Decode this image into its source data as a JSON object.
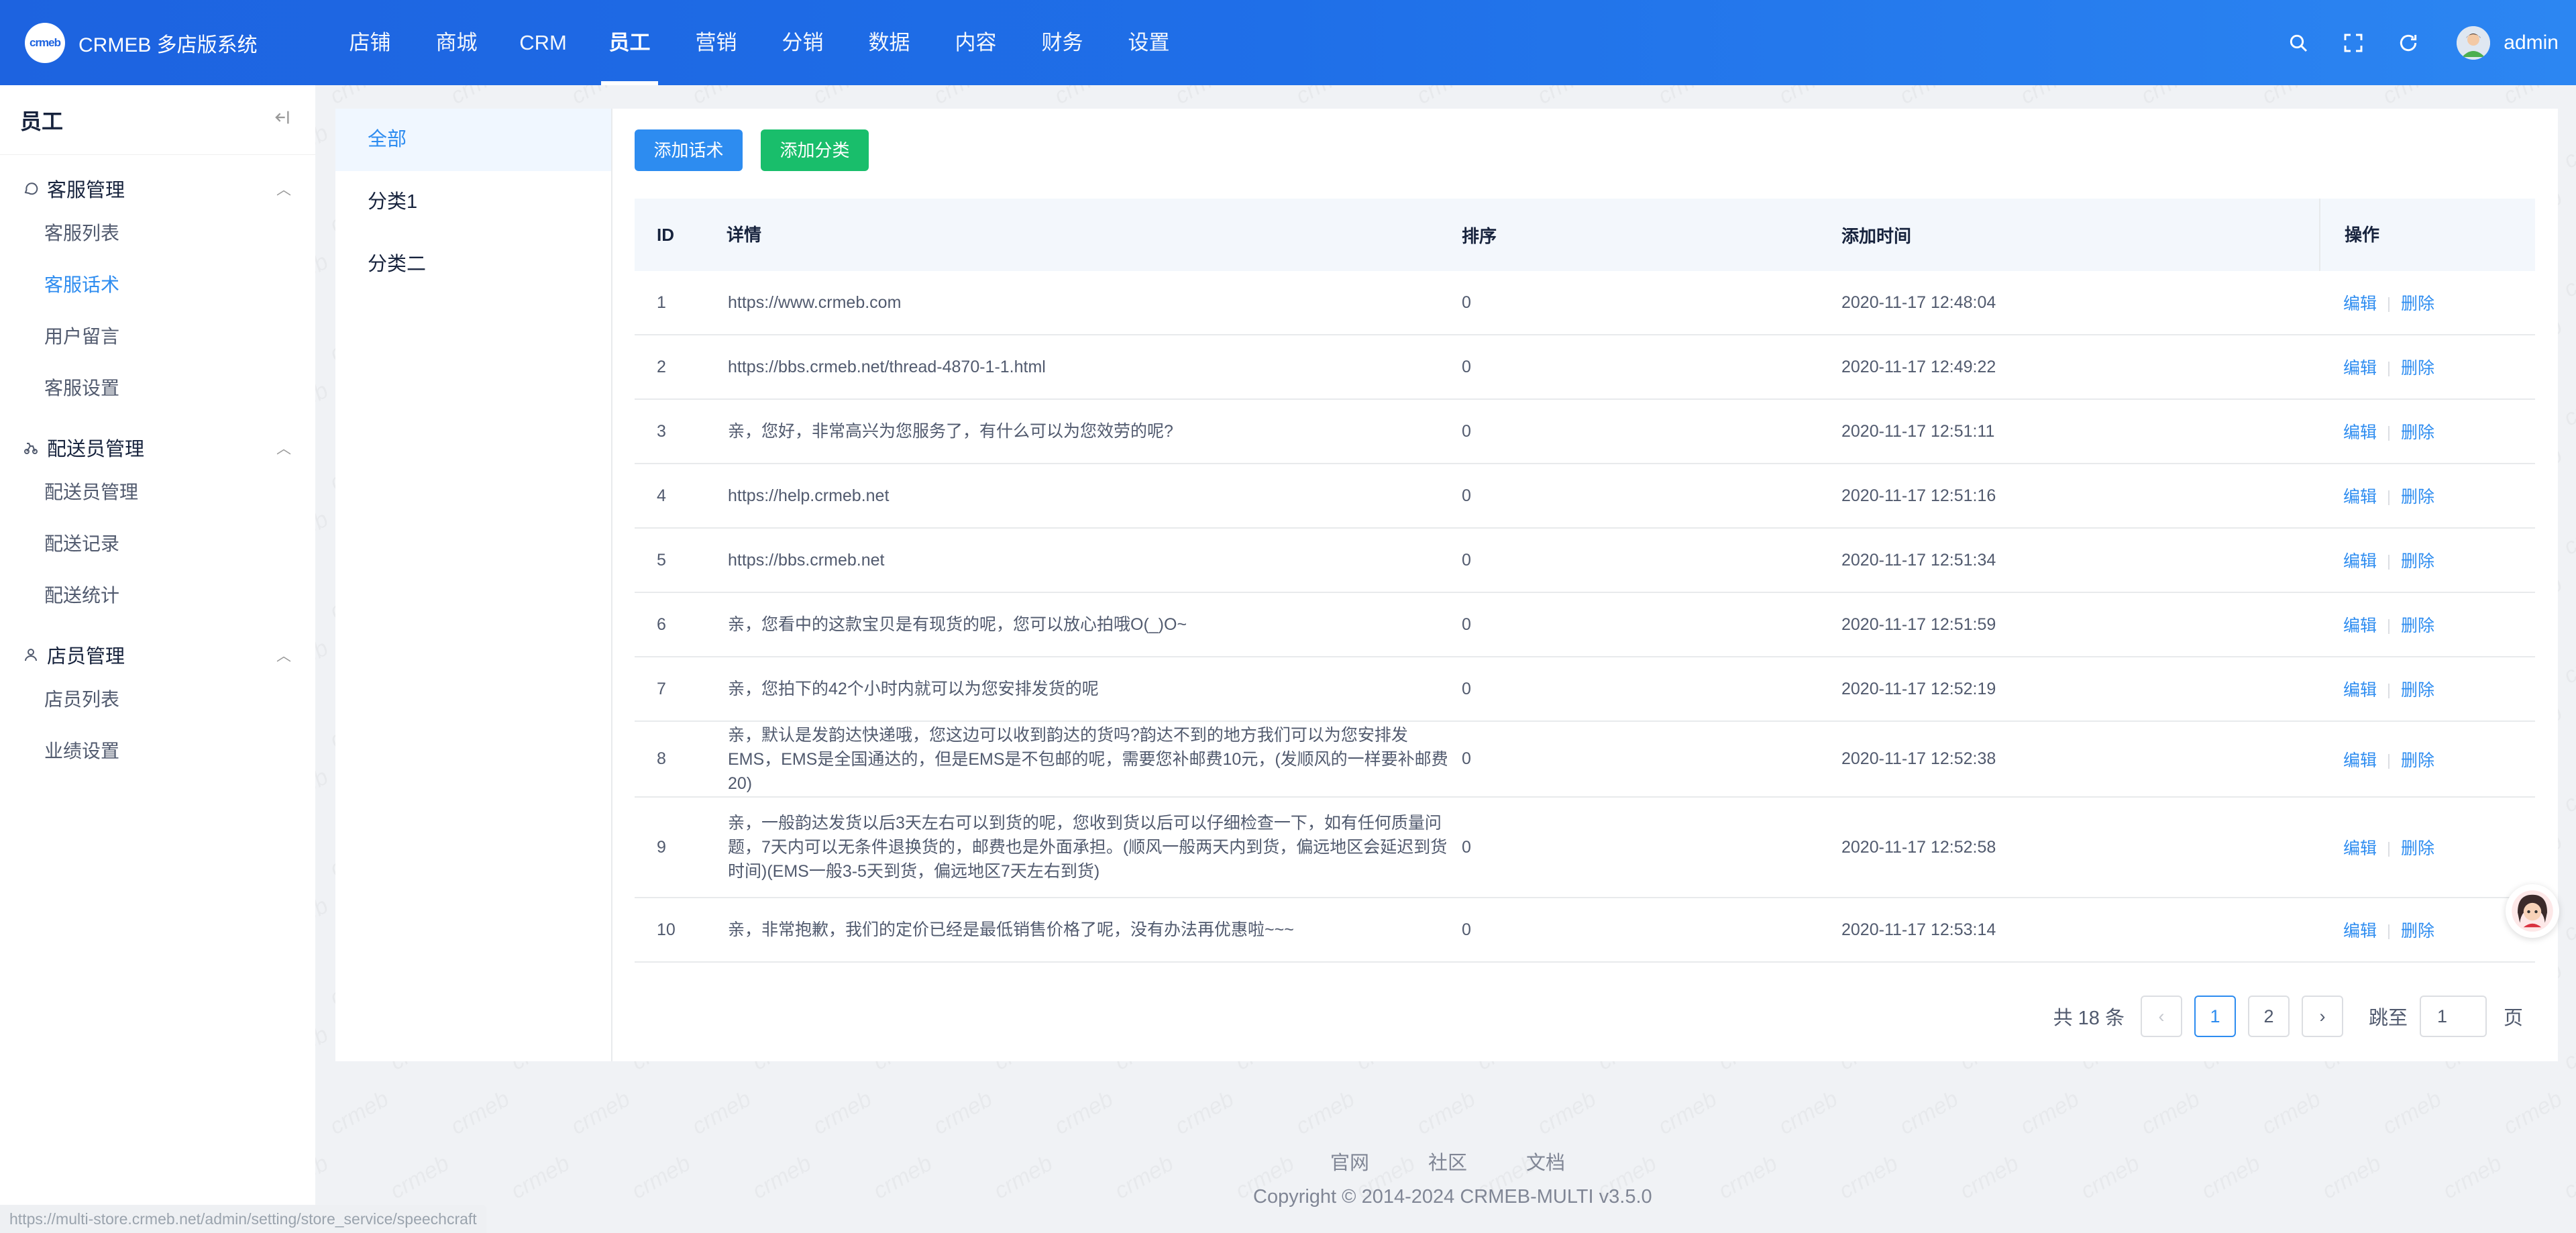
{
  "header": {
    "logo_mark": "crmeb",
    "app_title": "CRMEB 多店版系统",
    "nav": [
      "店铺",
      "商城",
      "CRM",
      "员工",
      "营销",
      "分销",
      "数据",
      "内容",
      "财务",
      "设置"
    ],
    "active_nav": "员工",
    "user_name": "admin",
    "icons": [
      "search-icon",
      "fullscreen-icon",
      "refresh-icon"
    ]
  },
  "sidebar": {
    "title": "员工",
    "groups": [
      {
        "label": "客服管理",
        "icon": "chat-icon",
        "items": [
          "客服列表",
          "客服话术",
          "用户留言",
          "客服设置"
        ]
      },
      {
        "label": "配送员管理",
        "icon": "delivery-icon",
        "items": [
          "配送员管理",
          "配送记录",
          "配送统计"
        ]
      },
      {
        "label": "店员管理",
        "icon": "user-icon",
        "items": [
          "店员列表",
          "业绩设置"
        ]
      }
    ],
    "active_item": "客服话术"
  },
  "submenu": {
    "items": [
      "全部",
      "分类1",
      "分类二"
    ],
    "active": "全部"
  },
  "toolbar": {
    "add_speech": "添加话术",
    "add_category": "添加分类"
  },
  "table": {
    "headers": {
      "id": "ID",
      "detail": "详情",
      "sort": "排序",
      "time": "添加时间",
      "op": "操作"
    },
    "op_edit": "编辑",
    "op_delete": "删除",
    "rows": [
      {
        "id": "1",
        "detail": "https://www.crmeb.com",
        "sort": "0",
        "time": "2020-11-17 12:48:04"
      },
      {
        "id": "2",
        "detail": "https://bbs.crmeb.net/thread-4870-1-1.html",
        "sort": "0",
        "time": "2020-11-17 12:49:22"
      },
      {
        "id": "3",
        "detail": "亲，您好，非常高兴为您服务了，有什么可以为您效劳的呢?",
        "sort": "0",
        "time": "2020-11-17 12:51:11"
      },
      {
        "id": "4",
        "detail": "https://help.crmeb.net",
        "sort": "0",
        "time": "2020-11-17 12:51:16"
      },
      {
        "id": "5",
        "detail": "https://bbs.crmeb.net",
        "sort": "0",
        "time": "2020-11-17 12:51:34"
      },
      {
        "id": "6",
        "detail": "亲，您看中的这款宝贝是有现货的呢，您可以放心拍哦O(_)O~",
        "sort": "0",
        "time": "2020-11-17 12:51:59"
      },
      {
        "id": "7",
        "detail": "亲，您拍下的42个小时内就可以为您安排发货的呢",
        "sort": "0",
        "time": "2020-11-17 12:52:19"
      },
      {
        "id": "8",
        "detail": "亲，默认是发韵达快递哦，您这边可以收到韵达的货吗?韵达不到的地方我们可以为您安排发EMS，EMS是全国通达的，但是EMS是不包邮的呢，需要您补邮费10元，(发顺风的一样要补邮费20)",
        "sort": "0",
        "time": "2020-11-17 12:52:38"
      },
      {
        "id": "9",
        "detail": "亲，一般韵达发货以后3天左右可以到货的呢，您收到货以后可以仔细检查一下，如有任何质量问题，7天内可以无条件退换货的，邮费也是外面承担。(顺风一般两天内到货，偏远地区会延迟到货时间)(EMS一般3-5天到货，偏远地区7天左右到货)",
        "sort": "0",
        "time": "2020-11-17 12:52:58"
      },
      {
        "id": "10",
        "detail": "亲，非常抱歉，我们的定价已经是最低销售价格了呢，没有办法再优惠啦~~~",
        "sort": "0",
        "time": "2020-11-17 12:53:14"
      }
    ]
  },
  "pagination": {
    "total_text": "共 18 条",
    "pages": [
      "1",
      "2"
    ],
    "current": "1",
    "jump_label": "跳至",
    "jump_value": "1",
    "page_suffix": "页"
  },
  "footer": {
    "links": [
      "官网",
      "社区",
      "文档"
    ],
    "copyright": "Copyright © 2014-2024 CRMEB-MULTI v3.5.0"
  },
  "status_bar_url": "https://multi-store.crmeb.net/admin/setting/store_service/speechcraft",
  "watermark_text": "crmeb",
  "colors": {
    "header_start": "#1d63e0",
    "header_end": "#2c86f2",
    "primary": "#2d8cf0",
    "success": "#19be6b"
  }
}
